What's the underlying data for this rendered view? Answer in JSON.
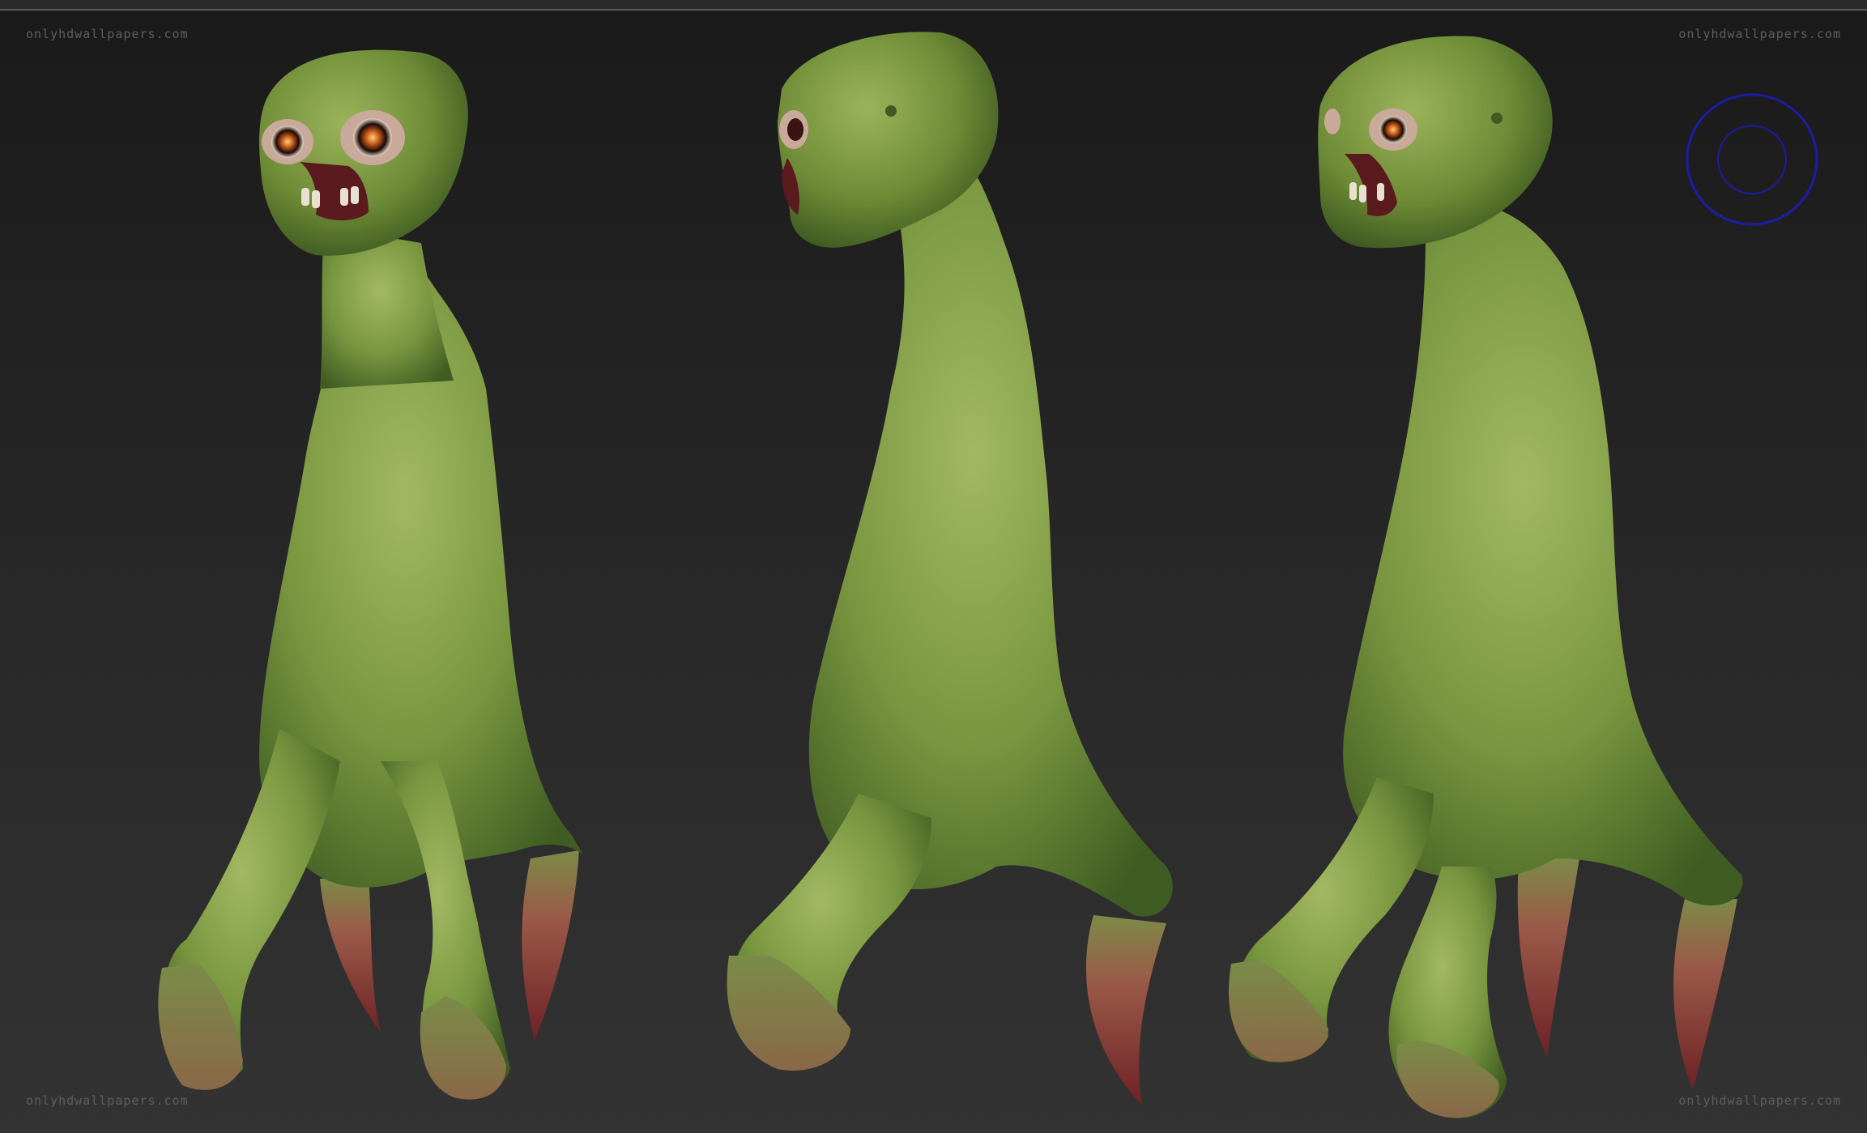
{
  "watermarks": {
    "top_left": "onlyhdwallpapers.com",
    "top_right": "onlyhdwallpapers.com",
    "bottom_left": "onlyhdwallpapers.com",
    "bottom_right": "onlyhdwallpapers.com"
  },
  "figures": [
    "front-three-quarter-view",
    "side-view",
    "three-quarter-view"
  ],
  "colors": {
    "background_top": "#1a1a1a",
    "background_bottom": "#333333",
    "skin_light": "#9cb25a",
    "skin_mid": "#6f8c3a",
    "skin_dark": "#3e5a22",
    "tentacle": "#8a3a35",
    "gizmo_ring": "#1c1ca8"
  },
  "icons": {
    "navigation_gizmo": "rotation-gizmo-icon"
  }
}
